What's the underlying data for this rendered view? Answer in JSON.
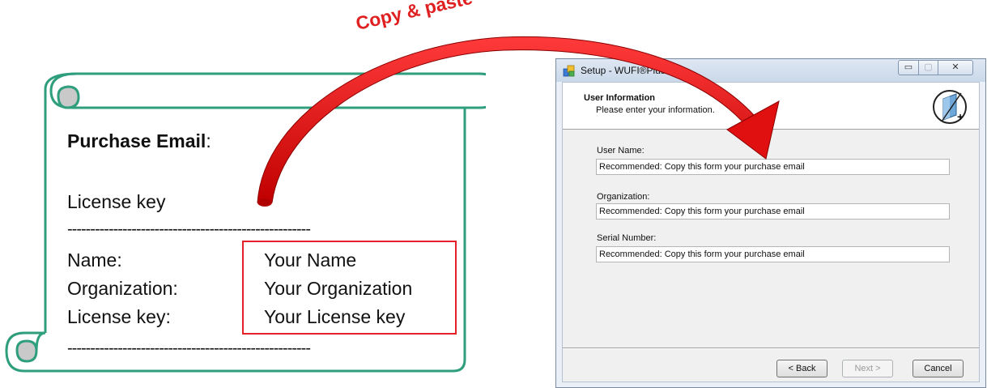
{
  "annotation": {
    "arrow_label": "Copy & paste",
    "arrow_color": "#e02020"
  },
  "scroll": {
    "border_color": "#2f9e7c",
    "purchase_email_label": "Purchase Email",
    "purchase_email_colon": ":",
    "license_key_heading": "License key",
    "dash_line": "-----------------------------------------------------",
    "rows": [
      {
        "label": "Name:",
        "value": "Your Name"
      },
      {
        "label": "Organization:",
        "value": "Your Organization"
      },
      {
        "label": "License key:",
        "value": "Your License key"
      }
    ],
    "highlight_color": "#e4202a"
  },
  "window": {
    "title": "Setup - WUFI®Plus",
    "controls": {
      "minimize": "▭",
      "maximize": "▢",
      "close": "✕"
    },
    "header": {
      "title": "User Information",
      "subtitle": "Please enter your information."
    },
    "fields": [
      {
        "label": "User Name:",
        "value": "Recommended: Copy this form your purchase email"
      },
      {
        "label": "Organization:",
        "value": "Recommended: Copy this form your purchase email"
      },
      {
        "label": "Serial Number:",
        "value": "Recommended: Copy this form your purchase email"
      }
    ],
    "buttons": {
      "back": "< Back",
      "next": "Next >",
      "cancel": "Cancel"
    }
  }
}
